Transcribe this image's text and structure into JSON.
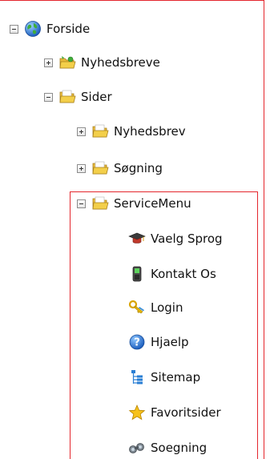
{
  "tree": {
    "root": {
      "label": "Forside",
      "icon": "globe-icon",
      "expanded": true
    },
    "nyhedsbreve": {
      "label": "Nyhedsbreve",
      "icon": "folder-special-icon",
      "expanded": false
    },
    "sider": {
      "label": "Sider",
      "icon": "folder-open-icon",
      "expanded": true
    },
    "nyhedsbrev": {
      "label": "Nyhedsbrev",
      "icon": "folder-icon",
      "expanded": false
    },
    "soegning_folder": {
      "label": "Søgning",
      "icon": "folder-icon",
      "expanded": false
    },
    "servicemenu": {
      "label": "ServiceMenu",
      "icon": "folder-open-icon",
      "expanded": true
    },
    "service_items": [
      {
        "label": "Vaelg Sprog",
        "icon": "graduation-cap-icon"
      },
      {
        "label": "Kontakt Os",
        "icon": "mobile-phone-icon"
      },
      {
        "label": "Login",
        "icon": "key-icon"
      },
      {
        "label": "Hjaelp",
        "icon": "help-icon"
      },
      {
        "label": "Sitemap",
        "icon": "sitemap-icon"
      },
      {
        "label": "Favoritsider",
        "icon": "star-icon"
      },
      {
        "label": "Soegning",
        "icon": "binoculars-icon"
      }
    ]
  },
  "colors": {
    "highlight_border": "#e4262d",
    "folder": "#f3cf4a"
  }
}
